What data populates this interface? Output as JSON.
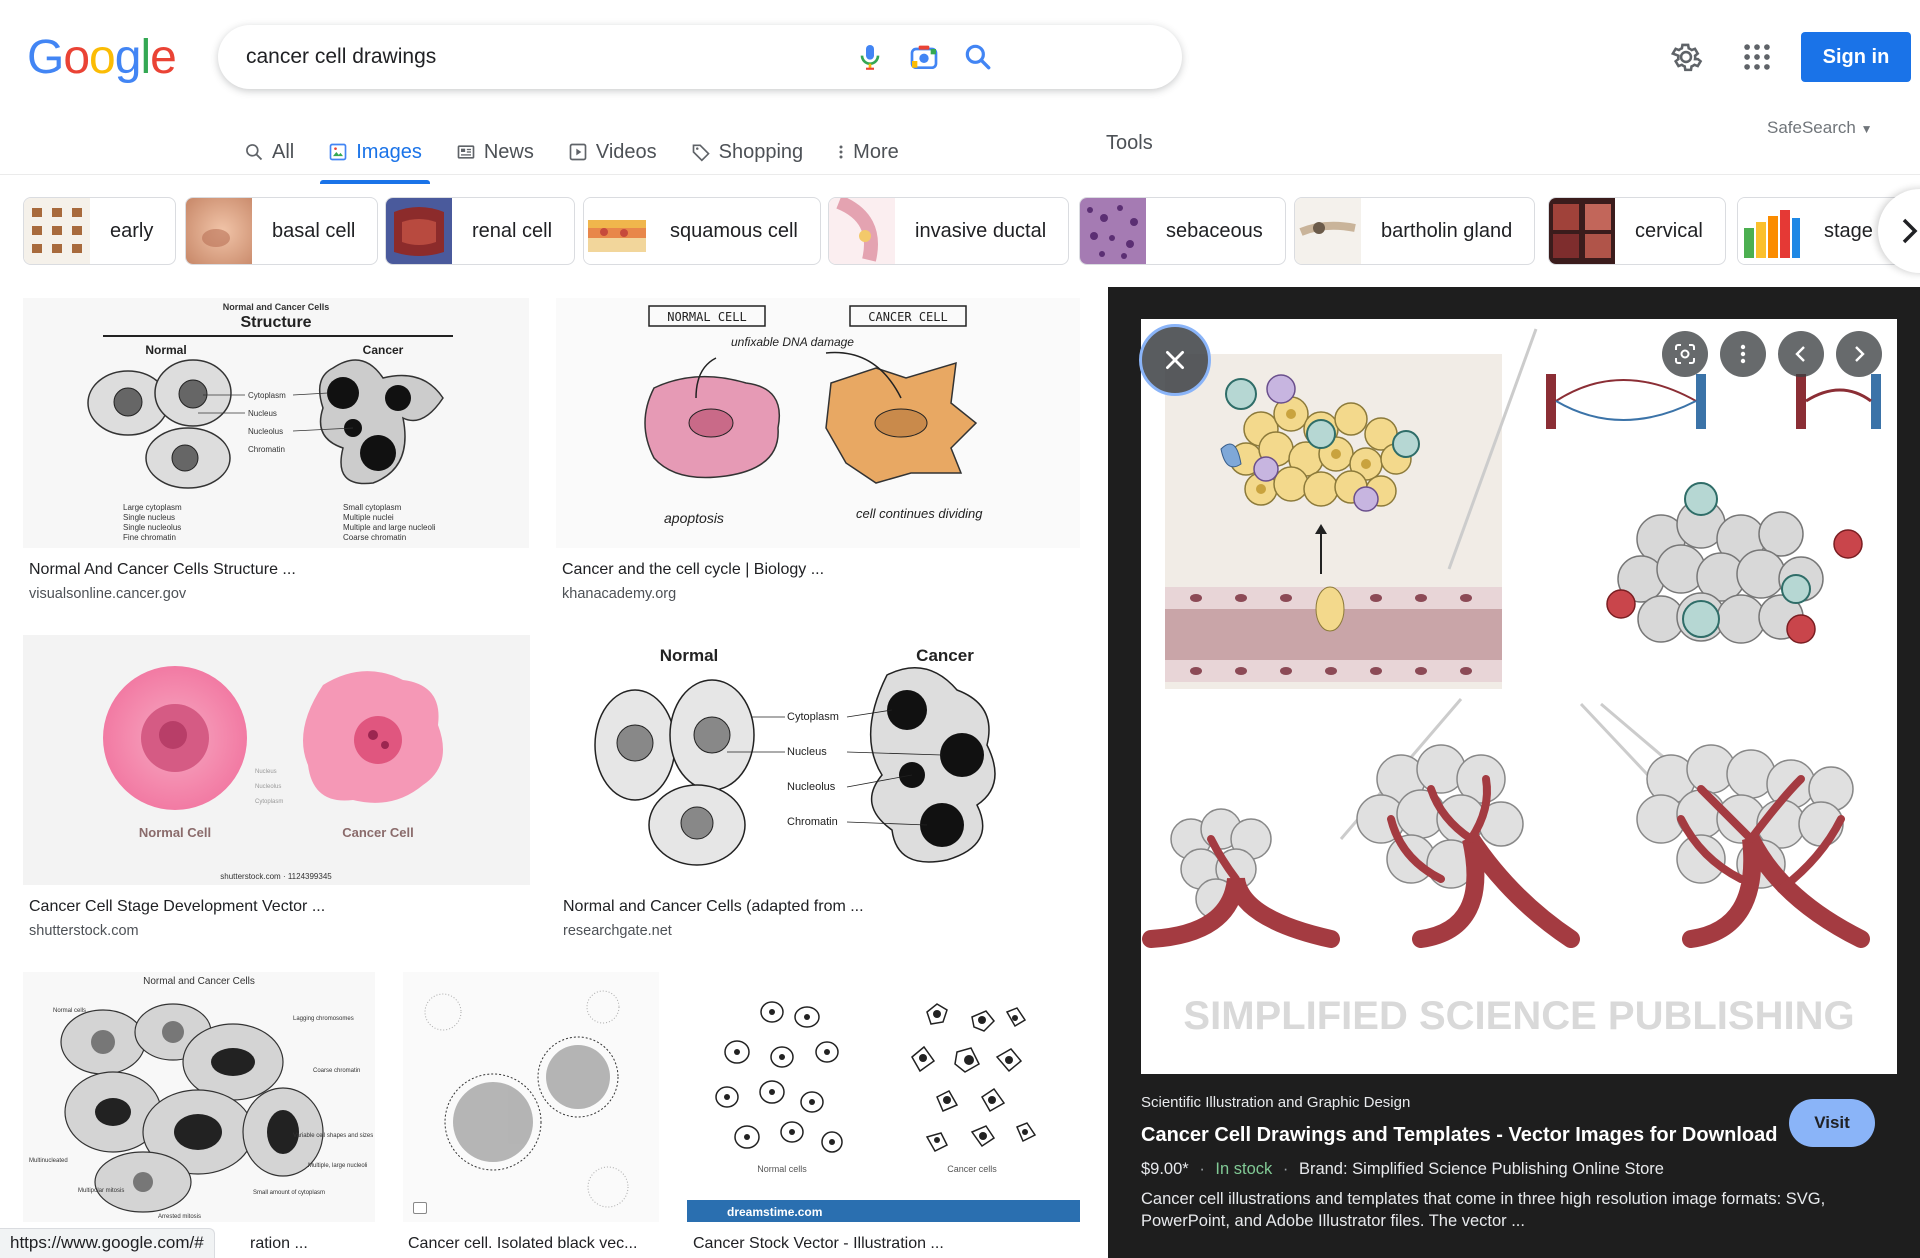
{
  "logo": {
    "text": "Google"
  },
  "search": {
    "query": "cancer cell drawings"
  },
  "header": {
    "signin": "Sign in"
  },
  "tabs": [
    {
      "label": "All"
    },
    {
      "label": "Images"
    },
    {
      "label": "News"
    },
    {
      "label": "Videos"
    },
    {
      "label": "Shopping"
    },
    {
      "label": "More"
    }
  ],
  "tools": "Tools",
  "safesearch": "SafeSearch",
  "chips": [
    {
      "label": "early"
    },
    {
      "label": "basal cell"
    },
    {
      "label": "renal cell"
    },
    {
      "label": "squamous cell"
    },
    {
      "label": "invasive ductal"
    },
    {
      "label": "sebaceous"
    },
    {
      "label": "bartholin gland"
    },
    {
      "label": "cervical"
    },
    {
      "label": "stage"
    }
  ],
  "results": [
    {
      "title": "Normal And Cancer Cells Structure ...",
      "source": "visualsonline.cancer.gov",
      "img": {
        "heading": "Normal and Cancer Cells",
        "subheading": "Structure",
        "left": "Normal",
        "right": "Cancer",
        "labels": [
          "Cytoplasm",
          "Nucleus",
          "Nucleolus",
          "Chromatin"
        ],
        "notes_left": [
          "Large cytoplasm",
          "Single nucleus",
          "Single nucleolus",
          "Fine chromatin"
        ],
        "notes_right": [
          "Small cytoplasm",
          "Multiple nuclei",
          "Multiple and large nucleoli",
          "Coarse chromatin"
        ]
      }
    },
    {
      "title": "Cancer and the cell cycle | Biology ...",
      "source": "khanacademy.org",
      "img": {
        "left": "NORMAL CELL",
        "right": "CANCER CELL",
        "note": "unfixable DNA damage",
        "bottom_left": "apoptosis",
        "bottom_right": "cell continues dividing"
      }
    },
    {
      "title": "Cancer Cell Stage Development Vector ...",
      "source": "shutterstock.com",
      "img": {
        "left": "Normal Cell",
        "right": "Cancer Cell",
        "labels": [
          "Nucleus",
          "Nucleolus",
          "Cytoplasm"
        ],
        "credit": "shutterstock.com · 1124399345"
      }
    },
    {
      "title": "Normal and Cancer Cells (adapted from ...",
      "source": "researchgate.net",
      "img": {
        "left": "Normal",
        "right": "Cancer",
        "labels": [
          "Cytoplasm",
          "Nucleus",
          "Nucleolus",
          "Chromatin"
        ]
      }
    },
    {
      "title": "ration ...",
      "img": {
        "heading": "Normal and Cancer Cells",
        "labels": [
          "Normal cells",
          "Lagging chromosomes",
          "Coarse chromatin",
          "Multinucleated",
          "Variable cell shapes and sizes",
          "Multiple, large nucleoli",
          "Multipolar mitosis",
          "Small amount of cytoplasm",
          "Arrested mitosis"
        ]
      }
    },
    {
      "title": "Cancer cell. Isolated black vec..."
    },
    {
      "title": "Cancer Stock Vector - Illustration ...",
      "img": {
        "left": "Normal cells",
        "right": "Cancer cells",
        "banner": "dreamstime.com"
      }
    }
  ],
  "panel": {
    "watermark": "SIMPLIFIED SCIENCE PUBLISHING",
    "category": "Scientific Illustration and Graphic Design",
    "title": "Cancer Cell Drawings and Templates - Vector Images for Download",
    "price": "$9.00*",
    "stock": "In stock",
    "brand": "Brand: Simplified Science Publishing Online Store",
    "description": "Cancer cell illustrations and templates that come in three high resolution image formats: SVG, PowerPoint, and Adobe Illustrator files. The vector ...",
    "visit": "Visit"
  },
  "status_url": "https://www.google.com/#",
  "colors": {
    "accent": "#1a73e8",
    "panel_bg": "#1e1e1e",
    "stock_green": "#81c995",
    "visit_bg": "#8ab4f8"
  }
}
